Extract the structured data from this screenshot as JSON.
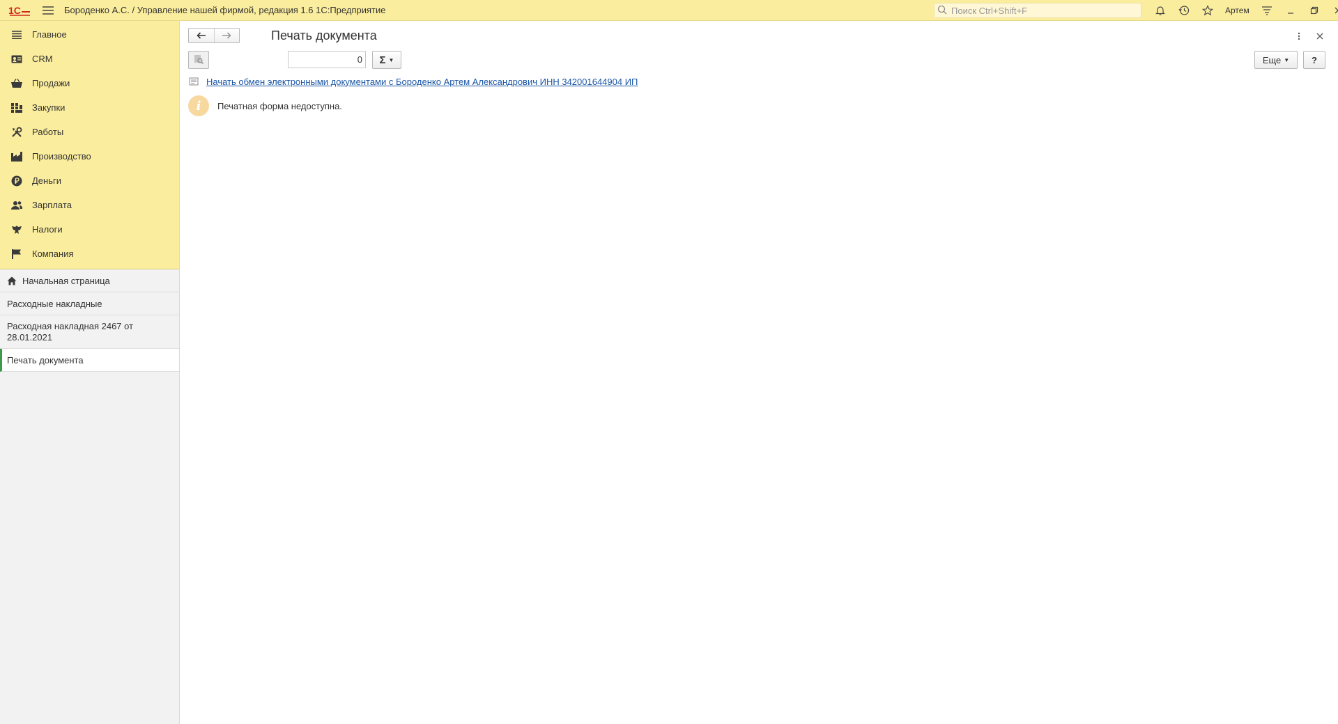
{
  "titlebar": {
    "app_title": "Бороденко А.С. / Управление нашей фирмой, редакция 1.6 1С:Предприятие",
    "search_placeholder": "Поиск Ctrl+Shift+F",
    "user_name": "Артем"
  },
  "sidebar": {
    "sections": [
      {
        "label": "Главное",
        "icon": "menu-lines-icon"
      },
      {
        "label": "CRM",
        "icon": "crm-card-icon"
      },
      {
        "label": "Продажи",
        "icon": "shopping-basket-icon"
      },
      {
        "label": "Закупки",
        "icon": "purchases-grid-icon"
      },
      {
        "label": "Работы",
        "icon": "tools-icon"
      },
      {
        "label": "Производство",
        "icon": "factory-icon"
      },
      {
        "label": "Деньги",
        "icon": "ruble-coin-icon"
      },
      {
        "label": "Зарплата",
        "icon": "people-icon"
      },
      {
        "label": "Налоги",
        "icon": "eagle-emblem-icon"
      },
      {
        "label": "Компания",
        "icon": "flag-icon"
      }
    ],
    "open_windows": [
      {
        "label": "Начальная страница",
        "icon": "home-icon"
      },
      {
        "label": "Расходные накладные"
      },
      {
        "label": "Расходная накладная 2467 от 28.01.2021"
      },
      {
        "label": "Печать документа",
        "active": true
      }
    ]
  },
  "form": {
    "title": "Печать документа",
    "copies_value": "0",
    "sum_symbol": "Σ",
    "more_label": "Еще",
    "help_label": "?",
    "edo_link": "Начать обмен электронными документами с Бороденко Артем Александрович ИНН 342001644904 ИП",
    "info_message": "Печатная форма недоступна."
  },
  "colors": {
    "header_bg": "#fbed9e",
    "sidebar_bg": "#f2f2f2",
    "link": "#1a56a6",
    "active_marker": "#3c9a4d",
    "logo_red": "#d0281e"
  }
}
